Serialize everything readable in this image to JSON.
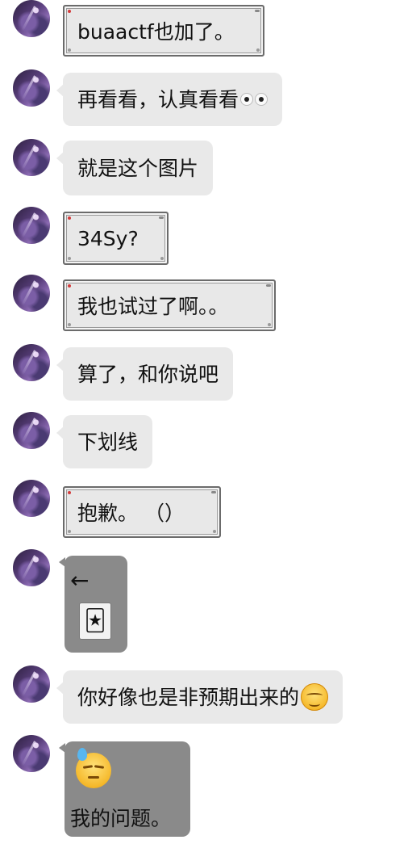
{
  "messages": [
    {
      "id": 1,
      "style": "frame",
      "text": "buaactf也加了。"
    },
    {
      "id": 2,
      "style": "bubble",
      "text": "再看看，认真看看",
      "emoji": "eyes-emoji"
    },
    {
      "id": 3,
      "style": "bubble",
      "text": "就是这个图片"
    },
    {
      "id": 4,
      "style": "frame",
      "text": "34Sy?"
    },
    {
      "id": 5,
      "style": "frame",
      "text": "我也试过了啊。。"
    },
    {
      "id": 6,
      "style": "bubble",
      "text": "算了，和你说吧"
    },
    {
      "id": 7,
      "style": "bubble",
      "text": "下划线"
    },
    {
      "id": 8,
      "style": "frame",
      "text": "抱歉。 （）"
    },
    {
      "id": 9,
      "style": "gray",
      "text": "←",
      "emoji": "joker-card-icon"
    },
    {
      "id": 10,
      "style": "bubble",
      "text": "你好像也是非预期出来的",
      "emoji": "smirk-emoji"
    },
    {
      "id": 11,
      "style": "gray",
      "text": "我的问题。",
      "emoji": "sweat-emoji"
    }
  ],
  "colors": {
    "bubble_bg": "#e9e9e9",
    "frame_border": "#6b6b6b",
    "gray_bubble_bg": "#8a8a8a",
    "avatar_purple": "#5a3f7d"
  }
}
